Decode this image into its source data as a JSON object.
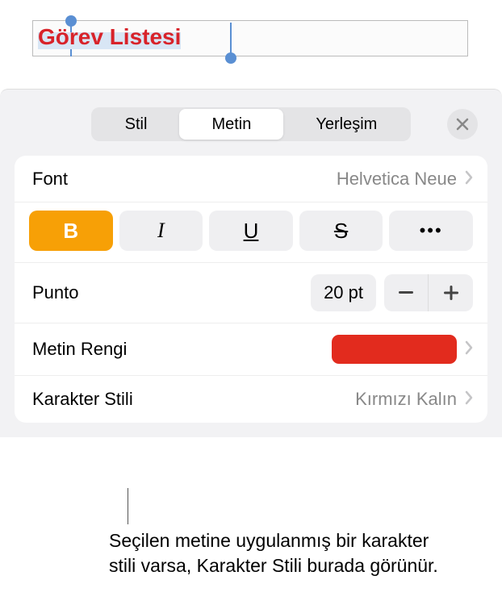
{
  "textbox": {
    "content": "Görev Listesi"
  },
  "panel": {
    "tabs": {
      "style": "Stil",
      "text": "Metin",
      "layout": "Yerleşim"
    }
  },
  "font": {
    "label": "Font",
    "value": "Helvetica Neue"
  },
  "styles": {
    "bold": "B",
    "italic": "I",
    "underline": "U",
    "strike": "S",
    "more": "•••"
  },
  "size": {
    "label": "Punto",
    "value": "20 pt"
  },
  "color": {
    "label": "Metin Rengi",
    "hex": "#e22b1e"
  },
  "charstyle": {
    "label": "Karakter Stili",
    "value": "Kırmızı Kalın"
  },
  "callout": {
    "text": "Seçilen metine uygulanmış bir karakter stili varsa, Karakter Stili burada görünür."
  }
}
